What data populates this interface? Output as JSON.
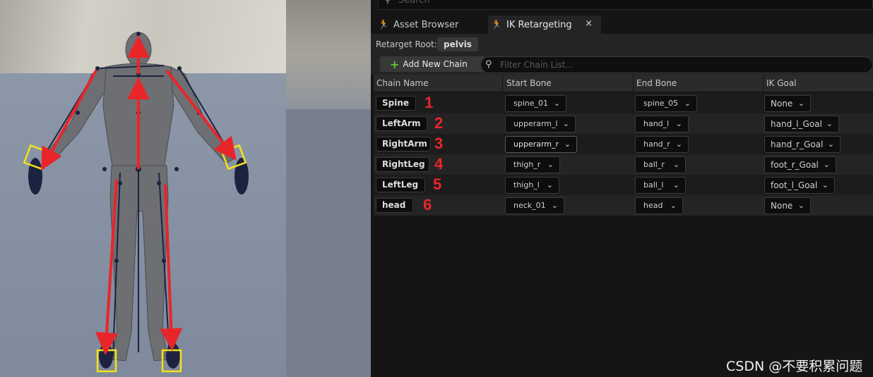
{
  "search": {
    "placeholder": "Search"
  },
  "tabs": [
    {
      "label": "Asset Browser",
      "icon": "running-figure-icon"
    },
    {
      "label": "IK Retargeting",
      "icon": "running-figure-icon",
      "close": "×"
    }
  ],
  "retarget": {
    "label": "Retarget Root:",
    "value": "pelvis"
  },
  "toolbar": {
    "add_label": "Add New Chain",
    "filter_placeholder": "Filter Chain List..."
  },
  "columns": [
    "Chain Name",
    "Start Bone",
    "End Bone",
    "IK Goal"
  ],
  "chains": [
    {
      "name": "Spine",
      "num": "1",
      "start": "spine_01",
      "end": "spine_05",
      "goal": "None"
    },
    {
      "name": "LeftArm",
      "num": "2",
      "start": "upperarm_l",
      "end": "hand_l",
      "goal": "hand_l_Goal"
    },
    {
      "name": "RightArm",
      "num": "3",
      "start": "upperarm_r",
      "end": "hand_r",
      "goal": "hand_r_Goal"
    },
    {
      "name": "RightLeg",
      "num": "4",
      "start": "thigh_r",
      "end": "ball_r",
      "goal": "foot_r_Goal"
    },
    {
      "name": "LeftLeg",
      "num": "5",
      "start": "thigh_l",
      "end": "ball_l",
      "goal": "foot_l_Goal"
    },
    {
      "name": "head",
      "num": "6",
      "start": "neck_01",
      "end": "head",
      "goal": "None"
    }
  ],
  "watermark": "CSDN @不要积累问题",
  "colors": {
    "annotation_red": "#e8262a",
    "ik_goal_yellow": "#f2e21a",
    "panel_bg": "#151515"
  }
}
